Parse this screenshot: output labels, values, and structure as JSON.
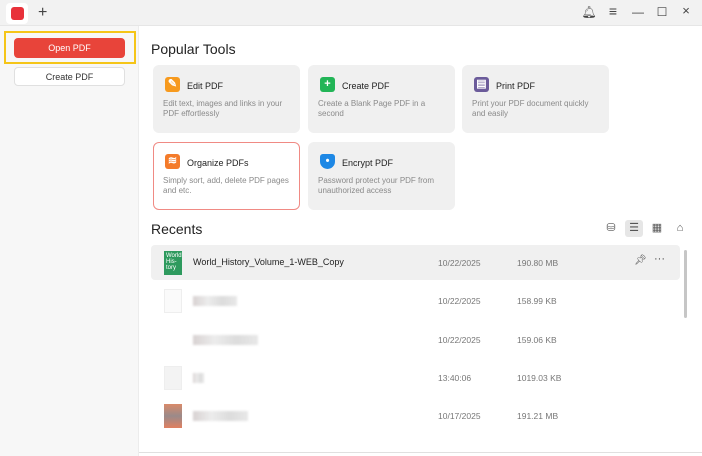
{
  "titlebar": {
    "new_tab": "+",
    "icons": [
      "bell-icon",
      "menu-icon",
      "minimize-icon",
      "maximize-icon",
      "close-icon"
    ],
    "glyphs": {
      "bell": "🔔︎",
      "menu": "≡",
      "min": "—",
      "max": "☐",
      "close": "×"
    }
  },
  "sidebar": {
    "open_pdf": "Open PDF",
    "create_pdf": "Create PDF"
  },
  "popular_tools": {
    "title": "Popular Tools",
    "cards": [
      {
        "title": "Edit PDF",
        "desc": "Edit text, images and links in your PDF effortlessly",
        "icon": "edit-icon",
        "color": "#f79a1e"
      },
      {
        "title": "Create PDF",
        "desc": "Create a Blank Page PDF in a second",
        "icon": "plus-icon",
        "color": "#22b557"
      },
      {
        "title": "Print PDF",
        "desc": "Print your PDF document quickly and easily",
        "icon": "printer-icon",
        "color": "#6b5b9a"
      },
      {
        "title": "Organize PDFs",
        "desc": "Simply sort, add, delete PDF pages and etc.",
        "icon": "layers-icon",
        "color": "#f47b2a"
      },
      {
        "title": "Encrypt PDF",
        "desc": "Password protect your PDF from unauthorized access",
        "icon": "shield-icon",
        "color": "#1e88e5"
      }
    ]
  },
  "recents": {
    "title": "Recents",
    "view_icons": [
      "filter-icon",
      "list-view-icon",
      "grid-view-icon",
      "clean-icon"
    ],
    "files": [
      {
        "name": "World_History_Volume_1-WEB_Copy",
        "date": "10/22/2025",
        "size": "190.80 MB"
      },
      {
        "name": "",
        "date": "10/22/2025",
        "size": "158.99 KB"
      },
      {
        "name": "",
        "date": "10/22/2025",
        "size": "159.06 KB"
      },
      {
        "name": "",
        "date": "13:40:06",
        "size": "1019.03 KB"
      },
      {
        "name": "",
        "date": "10/17/2025",
        "size": "191.21 MB"
      }
    ]
  },
  "colors": {
    "accent": "#e8443a",
    "highlight": "#f5c518"
  }
}
